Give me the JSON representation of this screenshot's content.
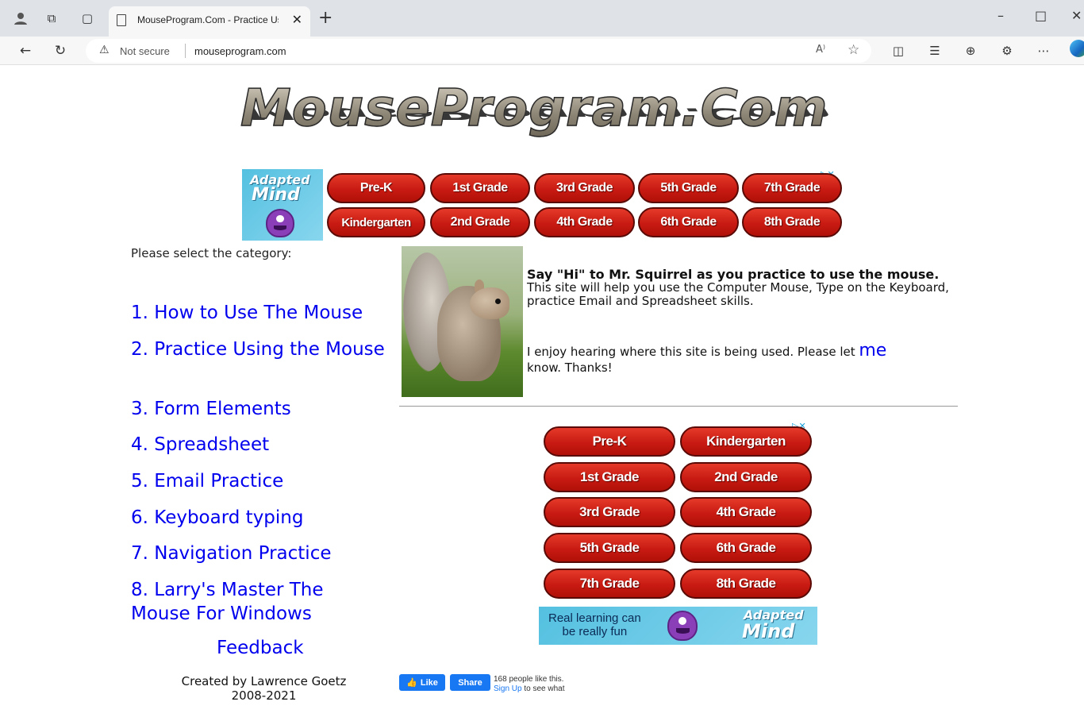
{
  "browser": {
    "tab_title": "MouseProgram.Com - Practice Us",
    "tab_close": "✕",
    "new_tab": "+",
    "security_label": "Not secure",
    "url": "mouseprogram.com",
    "read_aloud": "A⁾",
    "window_min": "–",
    "window_max": "□",
    "window_close": "✕"
  },
  "logo": {
    "text": "MouseProgram.Com"
  },
  "top_ad": {
    "brand_line1": "Adapted",
    "brand_line2": "Mind",
    "adchoices": "▷✕",
    "grades": [
      "Pre-K",
      "1st Grade",
      "3rd Grade",
      "5th Grade",
      "7th Grade",
      "Kindergarten",
      "2nd Grade",
      "4th Grade",
      "6th Grade",
      "8th Grade"
    ]
  },
  "sidebar": {
    "prompt": "Please select the category:",
    "links": [
      "1. How to Use The Mouse",
      "2. Practice Using the Mouse",
      "3. Form Elements",
      "4. Spreadsheet",
      "5. Email Practice",
      "6. Keyboard typing",
      "7. Navigation Practice",
      "8. Larry's Master The Mouse For Windows"
    ],
    "feedback": "Feedback",
    "credit_line1": "Created by Lawrence Goetz",
    "credit_line2": "2008-2021"
  },
  "main": {
    "heading": "Say \"Hi\" to Mr. Squirrel as you practice to use the mouse.",
    "description": "This site will help you use the Computer Mouse, Type on the Keyboard, practice Email and Spreadsheet skills.",
    "thanks_before": "I enjoy hearing where this site is being used. Please let ",
    "thanks_link": "me",
    "thanks_after": "know. Thanks!"
  },
  "bottom_ad": {
    "adchoices": "▷✕",
    "grades": [
      "Pre-K",
      "Kindergarten",
      "1st Grade",
      "2nd Grade",
      "3rd Grade",
      "4th Grade",
      "5th Grade",
      "6th Grade",
      "7th Grade",
      "8th Grade"
    ],
    "tagline_line1": "Real learning can",
    "tagline_line2": "be really fun",
    "brand_line1": "Adapted",
    "brand_line2": "Mind"
  },
  "facebook": {
    "like_label": "Like",
    "share_label": "Share",
    "count_text": "168 people like this.",
    "signup_link": "Sign Up",
    "signup_suffix": " to see what"
  },
  "colors": {
    "link": "#0000ee",
    "ad_button": "#c81a12",
    "fb_blue": "#1877f2"
  }
}
